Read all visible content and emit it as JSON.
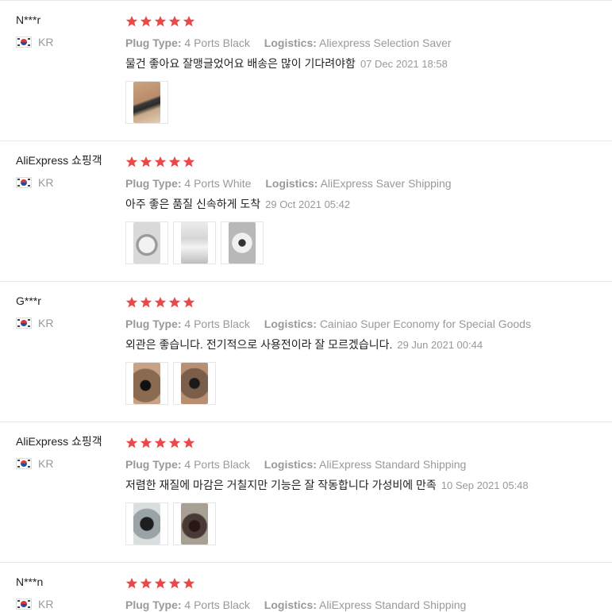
{
  "labels": {
    "plug_type": "Plug Type:",
    "logistics": "Logistics:"
  },
  "colors": {
    "star": "#e84a4a",
    "muted": "#999999",
    "text": "#222222"
  },
  "icons": {
    "star": "star-icon",
    "flag": "korea-flag-icon"
  },
  "reviews": [
    {
      "name": "N***r",
      "country": "KR",
      "rating": 5,
      "plug_type": "4 Ports Black",
      "logistics": "Aliexpress Selection Saver",
      "text": "물건 좋아요 잘맹글었어요 배송은 많이 기다려야함",
      "date": "07 Dec 2021 18:58",
      "photos": [
        "photo-hand-holding-device"
      ]
    },
    {
      "name": "AliExpress 쇼핑객",
      "country": "KR",
      "rating": 5,
      "plug_type": "4 Ports White",
      "logistics": "AliExpress Saver Shipping",
      "text": "아주 좋은 품질 신속하게 도착",
      "date": "29 Oct 2021 05:42",
      "photos": [
        "photo-white-plug-front",
        "photo-white-plug-side",
        "photo-white-plug-ports"
      ]
    },
    {
      "name": "G***r",
      "country": "KR",
      "rating": 5,
      "plug_type": "4 Ports Black",
      "logistics": "Cainiao Super Economy for Special Goods",
      "text": "외관은 좋습니다. 전기적으로 사용전이라 잘 모르겠습니다.",
      "date": "29 Jun 2021 00:44",
      "photos": [
        "photo-black-plug-1",
        "photo-black-plug-2"
      ]
    },
    {
      "name": "AliExpress 쇼핑객",
      "country": "KR",
      "rating": 5,
      "plug_type": "4 Ports Black",
      "logistics": "AliExpress Standard Shipping",
      "text": "저렴한 재질에 마감은 거칠지만 기능은 잘 작동합니다 가성비에 만족",
      "date": "10 Sep 2021 05:48",
      "photos": [
        "photo-black-plug-wrapped-1",
        "photo-black-plug-wrapped-2"
      ]
    },
    {
      "name": "N***n",
      "country": "KR",
      "rating": 5,
      "plug_type": "4 Ports Black",
      "logistics": "AliExpress Standard Shipping",
      "text": "",
      "date": "",
      "photos": []
    }
  ]
}
